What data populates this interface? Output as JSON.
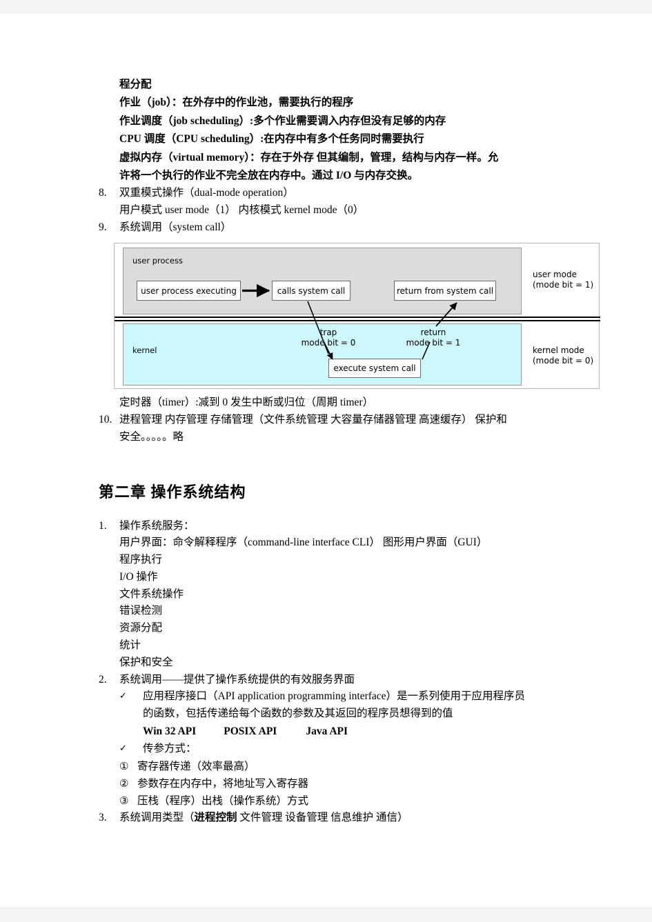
{
  "document": {
    "lead_block": [
      "程分配",
      "作业（job）：在外存中的作业池，需要执行的程序",
      "作业调度（job scheduling）:多个作业需要调入内存但没有足够的内存",
      "CPU 调度（CPU scheduling）:在内存中有多个任务同时需要执行",
      "虚拟内存（virtual memory）：存在于外存 但其编制，管理，结构与内存一样。允",
      "许将一个执行的作业不完全放在内存中。通过 I/O 与内存交换。"
    ],
    "item8": {
      "marker": "8.",
      "title": "双重模式操作（dual-mode operation）",
      "subline": "用户模式 user mode（1） 内核模式 kernel mode（0）"
    },
    "item9": {
      "marker": "9.",
      "title": "系统调用（system call）",
      "after_figure": "定时器（timer）:减到 0 发生中断或归位（周期 timer）"
    },
    "item10": {
      "marker": "10.",
      "line1": "进程管理 内存管理 存储管理（文件系统管理 大容量存储器管理 高速缓存） 保护和",
      "line2": "安全。。。。。略"
    },
    "chapter_heading": "第二章 操作系统结构",
    "item1": {
      "marker": "1.",
      "title": "操作系统服务：",
      "sublines": [
        "用户界面：命令解释程序（command-line interface CLI） 图形用户界面（GUI）",
        "程序执行",
        "I/O 操作",
        "文件系统操作",
        "错误检测",
        "资源分配",
        "统计",
        "保护和安全"
      ]
    },
    "item2": {
      "marker": "2.",
      "title": "系统调用——提供了操作系统提供的有效服务界面",
      "check_glyph": "✓",
      "check1_line1": "应用程序接口（API application programming interface）是一系列使用于应用程序员",
      "check1_line2": "的函数，包括传递给每个函数的参数及其返回的程序员想得到的值",
      "api_list": [
        "Win 32 API",
        "POSIX API",
        "Java API"
      ],
      "check2": "传参方式：",
      "numbered": [
        {
          "glyph": "①",
          "text": "寄存器传递（效率最高）"
        },
        {
          "glyph": "②",
          "text": "参数存在内存中，将地址写入寄存器"
        },
        {
          "glyph": "③",
          "text": "压栈（程序）出栈（操作系统）方式"
        }
      ]
    },
    "item3": {
      "marker": "3.",
      "prefix": "系统调用类型（",
      "bold": "进程控制",
      "suffix": " 文件管理 设备管理 信息维护 通信）"
    }
  },
  "figure": {
    "user_band_label": "user process",
    "kernel_band_label": "kernel",
    "nodes": {
      "user_process_executing": "user process executing",
      "calls_system_call": "calls system call",
      "return_from_system_call": "return from system call",
      "execute_system_call": "execute system call"
    },
    "annotations": {
      "trap_line1": "trap",
      "trap_line2": "mode bit = 0",
      "return_line1": "return",
      "return_line2": "mode bit = 1"
    },
    "side_labels": {
      "user_mode_line1": "user mode",
      "user_mode_line2": "(mode bit = 1)",
      "kernel_mode_line1": "kernel mode",
      "kernel_mode_line2": "(mode bit = 0)"
    },
    "colors": {
      "user_band": "#dcdcdc",
      "kernel_band": "#ccf7fb",
      "border": "#9a9a9a"
    }
  }
}
